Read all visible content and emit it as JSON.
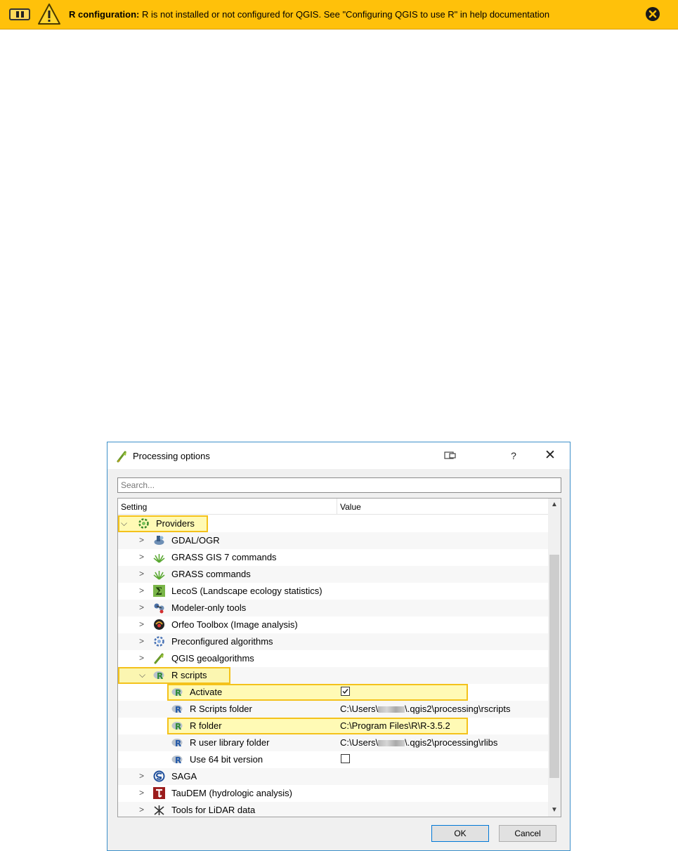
{
  "warning_bar": {
    "title": "R configuration:",
    "message": "R is not installed or not configured for QGIS. See \"Configuring QGIS to use R\" in help documentation",
    "icons": [
      "pause-icon",
      "warning-icon",
      "close-icon"
    ],
    "colors": {
      "background": "#ffc10a"
    }
  },
  "dialog": {
    "title": "Processing options",
    "help_label": "?",
    "close_label": "✕",
    "search_placeholder": "Search...",
    "columns": {
      "setting": "Setting",
      "value": "Value"
    },
    "rows": [
      {
        "label": "Providers",
        "icon": "gear-icon",
        "expanded": true,
        "highlighted": true
      },
      {
        "label": "GDAL/OGR",
        "icon": "gdal-icon",
        "expanded": false
      },
      {
        "label": "GRASS GIS 7 commands",
        "icon": "grass-icon",
        "expanded": false
      },
      {
        "label": "GRASS commands",
        "icon": "grass-icon",
        "expanded": false
      },
      {
        "label": "LecoS (Landscape ecology statistics)",
        "icon": "lecos-icon",
        "expanded": false
      },
      {
        "label": "Modeler-only tools",
        "icon": "modeler-icon",
        "expanded": false
      },
      {
        "label": "Orfeo Toolbox (Image analysis)",
        "icon": "orfeo-icon",
        "expanded": false
      },
      {
        "label": "Preconfigured algorithms",
        "icon": "gear-icon",
        "expanded": false
      },
      {
        "label": "QGIS geoalgorithms",
        "icon": "qgis-icon",
        "expanded": false
      },
      {
        "label": "R scripts",
        "icon": "r-icon",
        "expanded": true,
        "highlighted": true
      },
      {
        "label": "Activate",
        "icon": "r-icon",
        "value_checked": true,
        "highlighted": true
      },
      {
        "label": "R Scripts folder",
        "icon": "r-icon",
        "value": "C:\\Users\\",
        "value_suffix": "\\.qgis2\\processing\\rscripts"
      },
      {
        "label": "R folder",
        "icon": "r-icon",
        "value": "C:\\Program Files\\R\\R-3.5.2",
        "highlighted": true
      },
      {
        "label": "R user library folder",
        "icon": "r-icon",
        "value": "C:\\Users\\",
        "value_suffix": "\\.qgis2\\processing\\rlibs"
      },
      {
        "label": "Use 64 bit version",
        "icon": "r-icon",
        "value_checked": false
      },
      {
        "label": "SAGA",
        "icon": "saga-icon",
        "expanded": false
      },
      {
        "label": "TauDEM (hydrologic analysis)",
        "icon": "taudem-icon",
        "expanded": false
      },
      {
        "label": "Tools for LiDAR data",
        "icon": "lidar-icon",
        "expanded": false
      }
    ],
    "buttons": {
      "ok": "OK",
      "cancel": "Cancel"
    },
    "colors": {
      "highlight_border": "#f4c21b",
      "highlight_fill": "#fff578",
      "r_icon": "#2d8a34"
    }
  }
}
